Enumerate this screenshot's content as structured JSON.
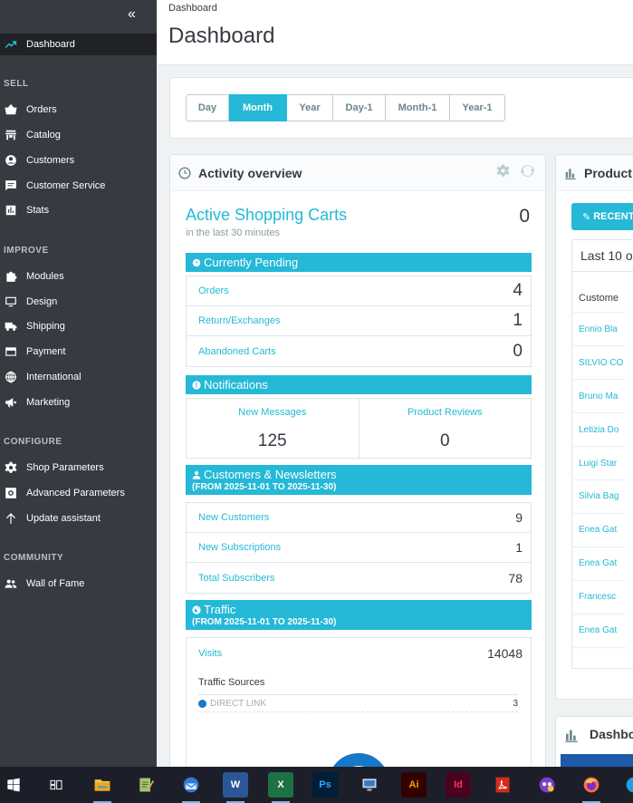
{
  "sidebar": {
    "collapse_icon": "«",
    "active": {
      "label": "Dashboard",
      "icon": "trending-up-icon"
    },
    "sections": {
      "sell": "SELL",
      "improve": "IMPROVE",
      "configure": "CONFIGURE",
      "community": "COMMUNITY"
    },
    "sell_items": [
      {
        "label": "Orders",
        "icon": "basket-icon"
      },
      {
        "label": "Catalog",
        "icon": "store-icon"
      },
      {
        "label": "Customers",
        "icon": "account-circle-icon"
      },
      {
        "label": "Customer Service",
        "icon": "chat-icon"
      },
      {
        "label": "Stats",
        "icon": "bar-chart-icon"
      }
    ],
    "improve_items": [
      {
        "label": "Modules",
        "icon": "puzzle-icon"
      },
      {
        "label": "Design",
        "icon": "desktop-icon"
      },
      {
        "label": "Shipping",
        "icon": "truck-icon"
      },
      {
        "label": "Payment",
        "icon": "credit-card-icon"
      },
      {
        "label": "International",
        "icon": "globe-icon"
      },
      {
        "label": "Marketing",
        "icon": "megaphone-icon"
      }
    ],
    "configure_items": [
      {
        "label": "Shop Parameters",
        "icon": "settings-icon"
      },
      {
        "label": "Advanced Parameters",
        "icon": "settings-applications-icon"
      },
      {
        "label": "Update assistant",
        "icon": "arrow-up-icon"
      }
    ],
    "community_items": [
      {
        "label": "Wall of Fame",
        "icon": "people-icon"
      }
    ]
  },
  "header": {
    "breadcrumb": "Dashboard",
    "title": "Dashboard"
  },
  "period": {
    "buttons": [
      "Day",
      "Month",
      "Year",
      "Day-1",
      "Month-1",
      "Year-1"
    ],
    "active": "Month"
  },
  "activity": {
    "title": "Activity overview",
    "active_carts": {
      "title": "Active Shopping Carts",
      "subtitle": "in the last 30 minutes",
      "value": "0"
    },
    "pending": {
      "title": "Currently Pending",
      "rows": [
        {
          "label": "Orders",
          "value": "4"
        },
        {
          "label": "Return/Exchanges",
          "value": "1"
        },
        {
          "label": "Abandoned Carts",
          "value": "0"
        }
      ]
    },
    "notifications": {
      "title": "Notifications",
      "cells": [
        {
          "label": "New Messages",
          "value": "125"
        },
        {
          "label": "Product Reviews",
          "value": "0"
        }
      ]
    },
    "customers": {
      "title": "Customers & Newsletters",
      "range": "(FROM 2025-11-01 TO 2025-11-30)",
      "rows": [
        {
          "label": "New Customers",
          "value": "9"
        },
        {
          "label": "New Subscriptions",
          "value": "1"
        },
        {
          "label": "Total Subscribers",
          "value": "78"
        }
      ]
    },
    "traffic": {
      "title": "Traffic",
      "range": "(FROM 2025-11-01 TO 2025-11-30)",
      "visits_label": "Visits",
      "visits_value": "14048",
      "sources_label": "Traffic Sources",
      "source": {
        "label": "DIRECT LINK",
        "value": "3",
        "color": "#1778c8"
      }
    }
  },
  "products": {
    "title": "Product",
    "recent_button": "RECENT",
    "last10_title": "Last 10 o",
    "customer_col": "Custome",
    "customers": [
      "Ennio Bla",
      "SILVIO CO",
      "Bruno Ma",
      "Letizia Do",
      "Luigi Star",
      "Silvia Bag",
      "Enea Gat",
      "Enea Gat",
      "Francesc",
      "Enea Gat"
    ]
  },
  "dashboard2": {
    "title": "Dashbo"
  },
  "taskbar": {
    "items": [
      "start-icon",
      "task-view-icon",
      "file-explorer-icon",
      "notepad-icon",
      "thunderbird-icon",
      "word-icon",
      "excel-icon",
      "photoshop-icon",
      "network-icon",
      "illustrator-icon",
      "indesign-icon",
      "acrobat-icon",
      "app-icon",
      "firefox-icon",
      "edge-icon"
    ],
    "labels": {
      "word": "W",
      "excel": "X",
      "photoshop": "Ps",
      "illustrator": "Ai",
      "indesign": "Id"
    }
  },
  "colors": {
    "accent": "#25b9d7",
    "sidebar": "#363a41",
    "taskbar": "#1c1f29"
  }
}
